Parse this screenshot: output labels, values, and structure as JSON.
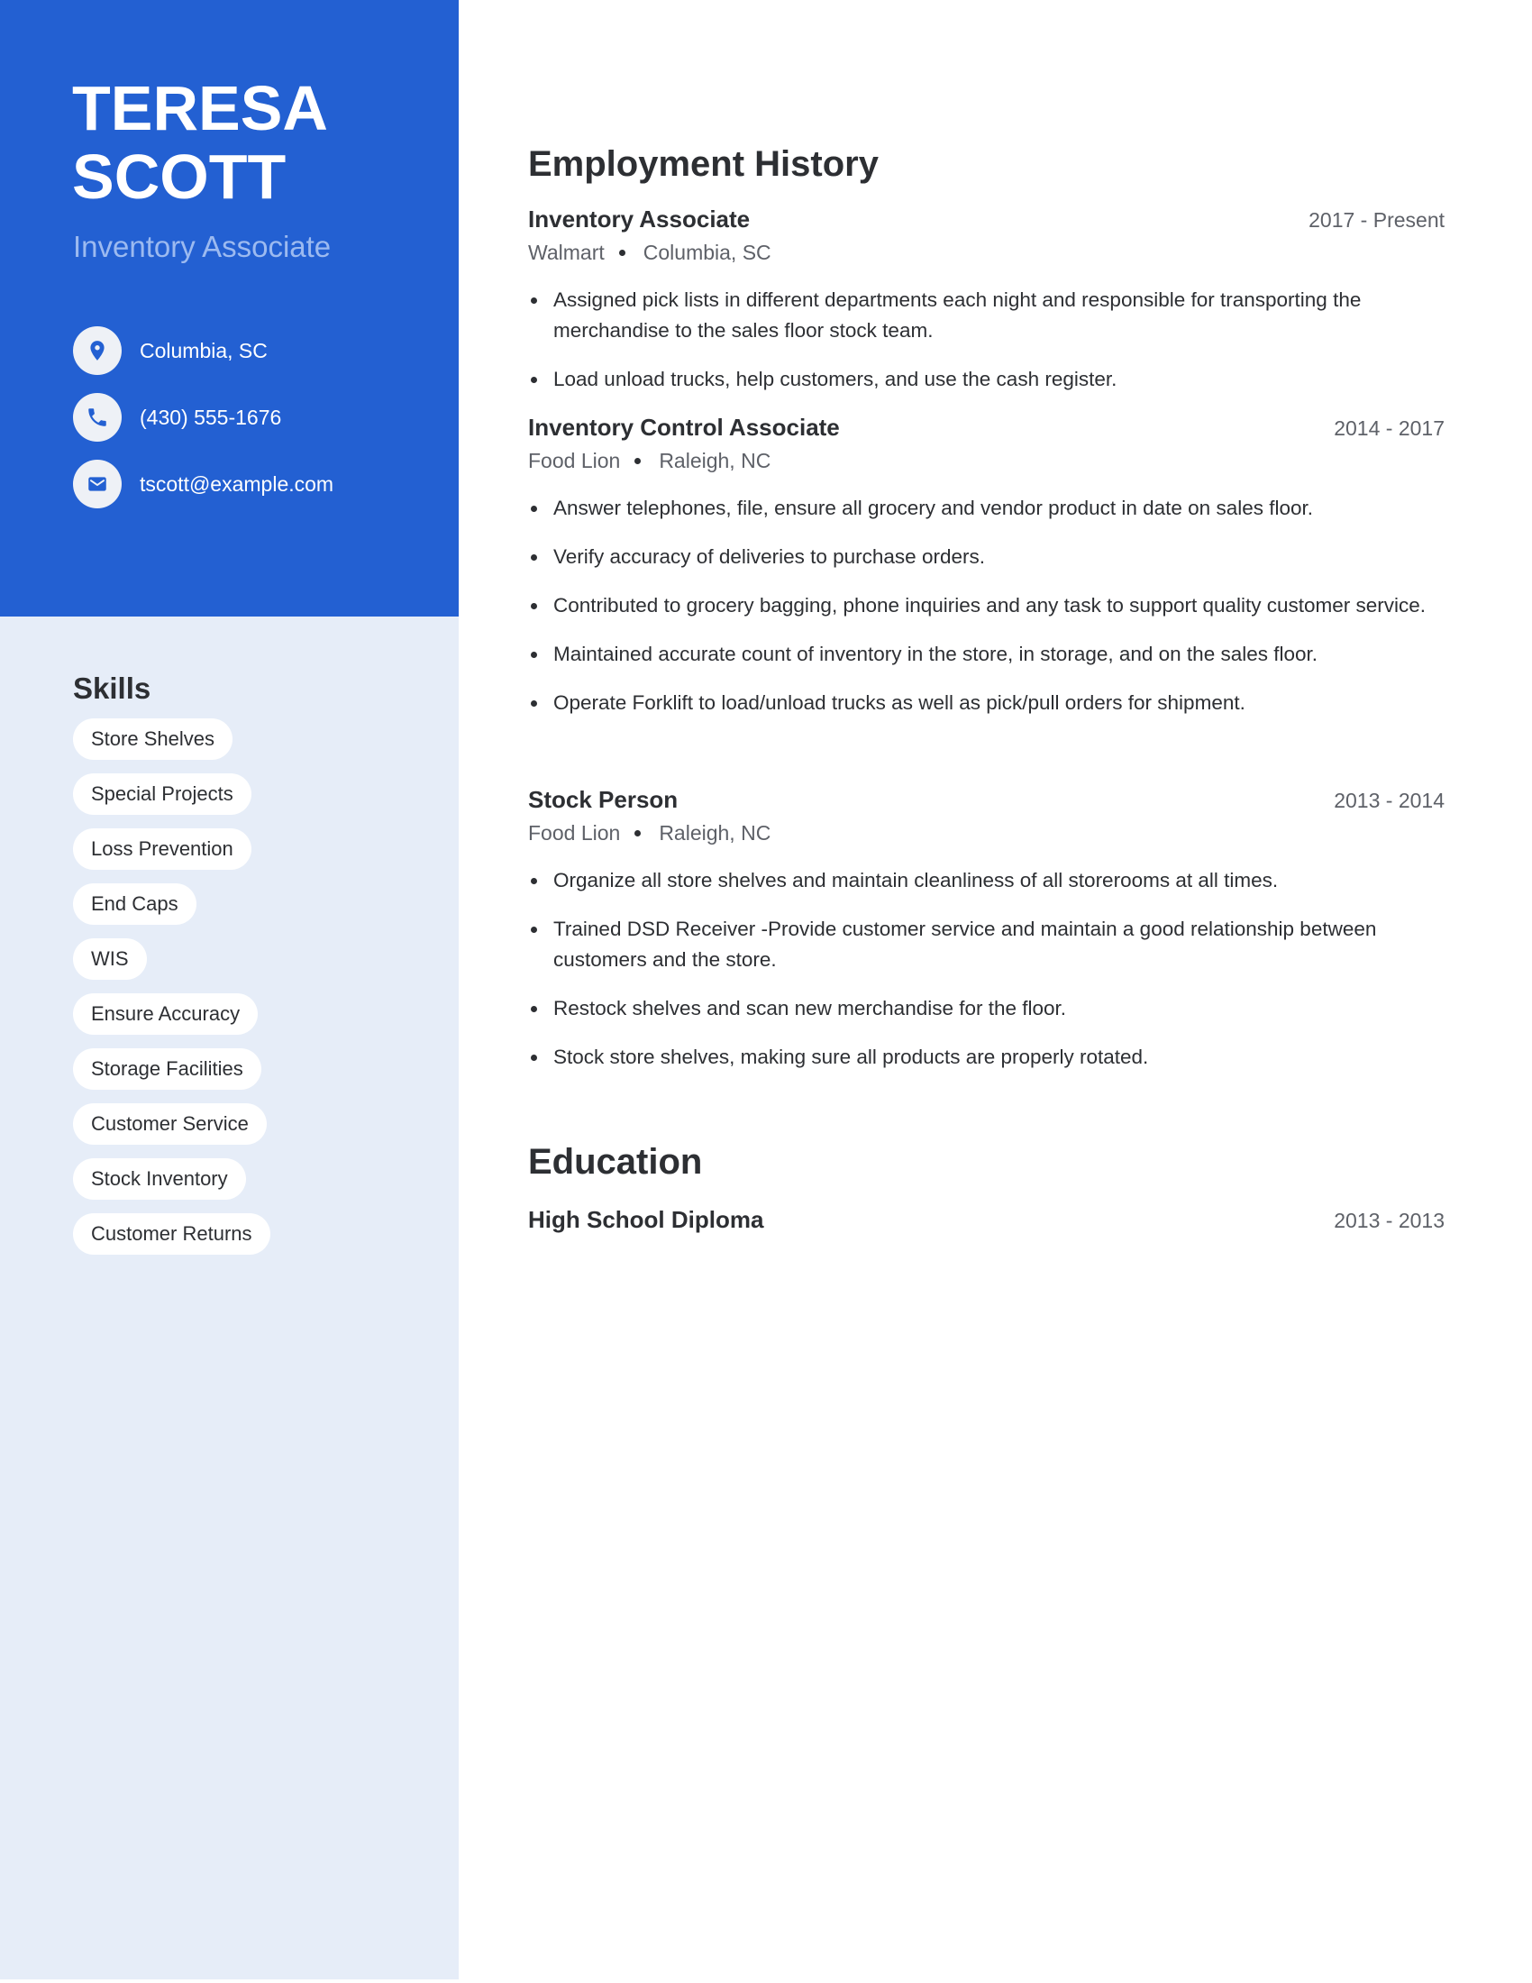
{
  "profile": {
    "first_name": "TERESA",
    "last_name": "SCOTT",
    "headline": "Inventory Associate",
    "contacts": [
      {
        "icon": "location-pin-icon",
        "text": "Columbia, SC"
      },
      {
        "icon": "phone-icon",
        "text": "(430) 555-1676"
      },
      {
        "icon": "envelope-icon",
        "text": "tscott@example.com"
      }
    ]
  },
  "skills": {
    "title": "Skills",
    "items": [
      "Store Shelves",
      "Special Projects",
      "Loss Prevention",
      "End Caps",
      "WIS",
      "Ensure Accuracy",
      "Storage Facilities",
      "Customer Service",
      "Stock Inventory",
      "Customer Returns"
    ]
  },
  "employment": {
    "title": "Employment History",
    "jobs": [
      {
        "title": "Inventory Associate",
        "dates": "2017 - Present",
        "company": "Walmart",
        "location": "Columbia, SC",
        "bullets": [
          "Assigned pick lists in different departments each night and responsible for transporting the merchandise to the sales floor stock team.",
          "Load unload trucks, help customers, and use the cash register."
        ]
      },
      {
        "title": "Inventory Control Associate",
        "dates": "2014 - 2017",
        "company": "Food Lion",
        "location": "Raleigh, NC",
        "bullets": [
          "Answer telephones, file, ensure all grocery and vendor product in date on sales floor.",
          "Verify accuracy of deliveries to purchase orders.",
          "Contributed to grocery bagging, phone inquiries and any task to support quality customer service.",
          "Maintained accurate count of inventory in the store, in storage, and on the sales floor.",
          "Operate Forklift to load/unload trucks as well as pick/pull orders for shipment."
        ]
      },
      {
        "title": "Stock Person",
        "dates": "2013 - 2014",
        "company": "Food Lion",
        "location": "Raleigh, NC",
        "bullets": [
          "Organize all store shelves and maintain cleanliness of all storerooms at all times.",
          "Trained DSD Receiver -Provide customer service and maintain a good relationship between customers and the store.",
          "Restock shelves and scan new merchandise for the floor.",
          "Stock store shelves, making sure all products are properly rotated."
        ]
      }
    ]
  },
  "education": {
    "title": "Education",
    "entries": [
      {
        "title": "High School Diploma",
        "dates": "2013 - 2013"
      }
    ]
  },
  "colors": {
    "accent": "#2360d2",
    "sidebar_bg": "#e6edf8",
    "headline": "#9cbaf0",
    "text": "#2d2f33",
    "muted": "#5e6168"
  }
}
